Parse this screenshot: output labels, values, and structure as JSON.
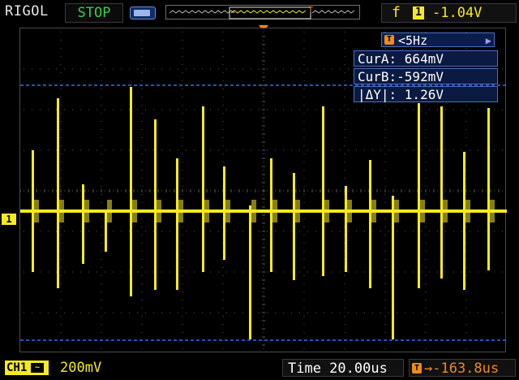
{
  "brand": "RIGOL",
  "run_state": "STOP",
  "trigger": {
    "edge_symbol": "f",
    "channel": "1",
    "level": "-1.04V"
  },
  "channel_marker": "1",
  "measurements": {
    "t_icon": "T",
    "frequency": "<5Hz",
    "cur_a": "CurA: 664mV",
    "cur_b": "CurB:-592mV",
    "delta_y": "|ΔY|: 1.26V"
  },
  "bottom": {
    "ch1_label": "CH1",
    "coupling_symbol": "~",
    "volts_per_div": "200mV",
    "timebase": "Time 20.00us",
    "t_icon": "T",
    "horizontal_offset": "→-163.8us"
  },
  "colors": {
    "trace": "#f5ea1f",
    "cursor": "#2f6bff",
    "grid": "#5a5a5a",
    "trigger_marker": "#f08a1c"
  }
}
